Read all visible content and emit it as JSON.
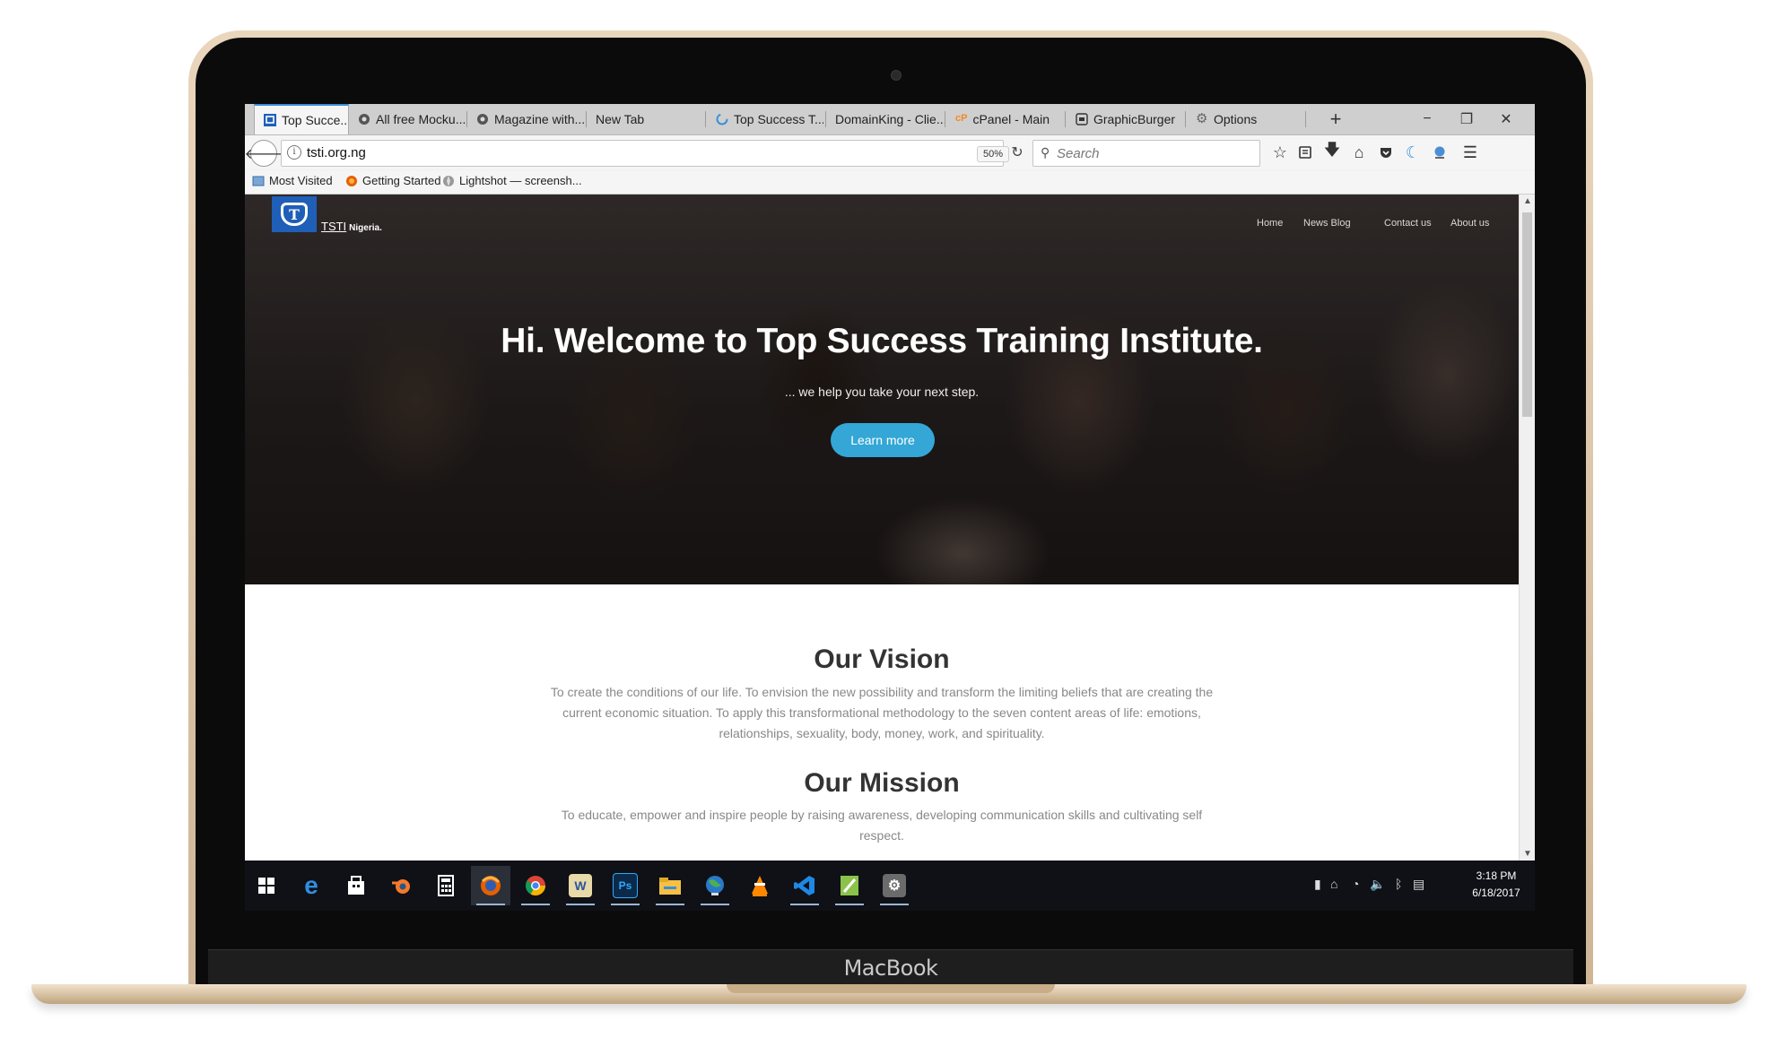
{
  "browser": {
    "tabs": [
      {
        "label": "Top Succe...",
        "active": true
      },
      {
        "label": "All free Mocku..."
      },
      {
        "label": "Magazine with..."
      },
      {
        "label": "New Tab"
      },
      {
        "label": "Top Success T..."
      },
      {
        "label": "DomainKing - Clie..."
      },
      {
        "label": "cPanel - Main"
      },
      {
        "label": "GraphicBurger"
      },
      {
        "label": "Options"
      }
    ],
    "new_tab": "+",
    "window_controls": {
      "minimize": "−",
      "restore": "❐",
      "close": "✕"
    },
    "url": "tsti.org.ng",
    "zoom": "50%",
    "search_placeholder": "Search",
    "bookmarks": [
      "Most Visited",
      "Getting Started",
      "Lightshot — screensh..."
    ]
  },
  "site": {
    "brand": "TSTI",
    "brand_suffix": "Nigeria.",
    "logo_mark": "T",
    "nav": [
      "Home",
      "News Blog",
      "Contact us",
      "About us"
    ],
    "hero_title": "Hi. Welcome to Top Success Training Institute.",
    "hero_subtitle": "... we help you take your next step.",
    "cta": "Learn more",
    "vision_title": "Our Vision",
    "vision_text": "To create the conditions of our life. To envision the new possibility and transform the limiting beliefs that are creating the current economic situation. To apply this transformational methodology to the seven content areas of life: emotions, relationships, sexuality, body, money, work, and spirituality.",
    "mission_title": "Our Mission",
    "mission_text": "To educate, empower and inspire people by raising awareness, developing communication skills and cultivating self respect."
  },
  "taskbar": {
    "time": "3:18 PM",
    "date": "6/18/2017",
    "apps": [
      "start",
      "edge",
      "store",
      "blender",
      "calculator",
      "firefox",
      "chrome",
      "word",
      "photoshop",
      "explorer",
      "earth",
      "vlc",
      "visual-studio",
      "notepad-plus",
      "settings"
    ]
  },
  "device_label": "MacBook",
  "colors": {
    "accent": "#34a7d6",
    "logo": "#1f5fb8",
    "taskbar": "#0f1116",
    "tab_highlight": "#3a8fd8"
  }
}
